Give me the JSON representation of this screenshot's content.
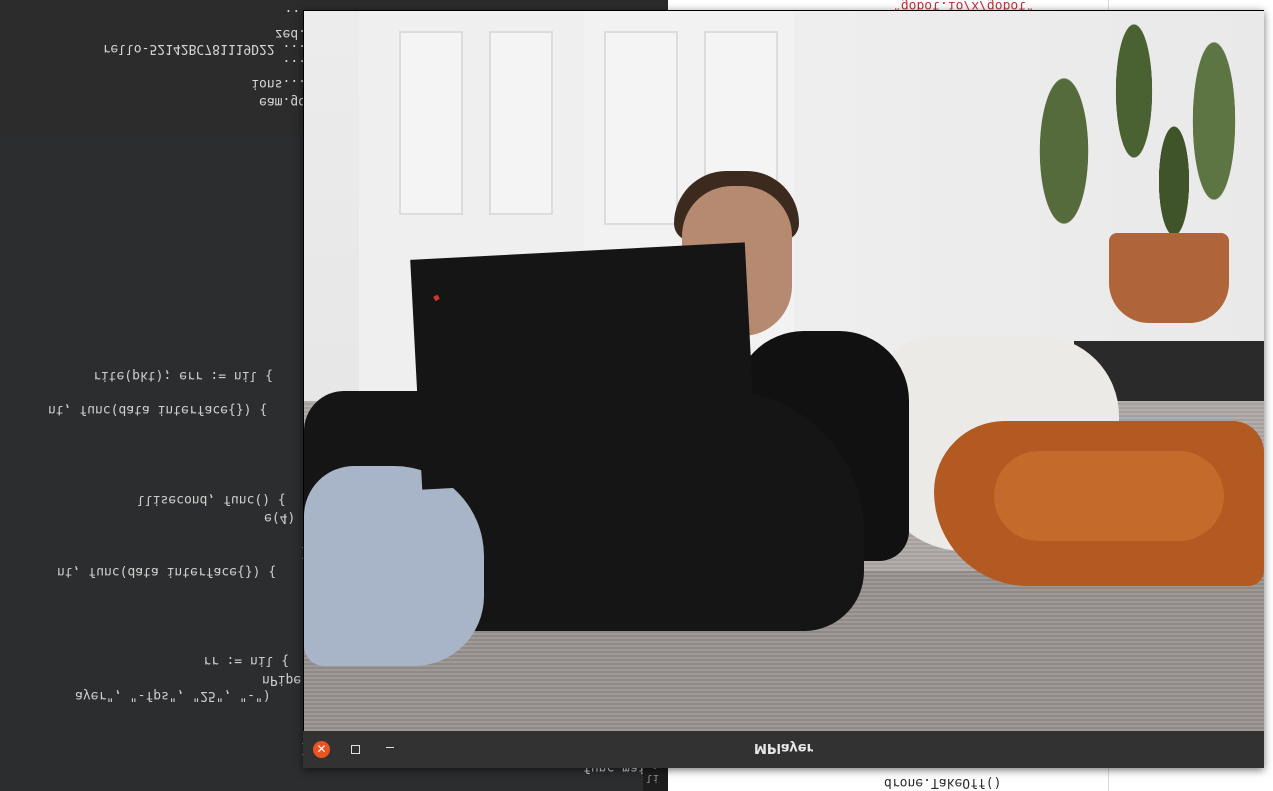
{
  "terminal": {
    "lines": [
      "...",
      "zed.",
      "rello-52142BC781119D22 ...",
      "...",
      "ions...",
      "eam.go"
    ]
  },
  "editor": {
    "lines": [
      "rite(pkt); err := nil {",
      "nt, func(data interface{}) {",
      "llisecond, func() {",
      "e(4)",
      ")",
      "nt, func(data interface{}) {",
      "rr := nil {",
      "nPipe()",
      "ayer\", \"-fps\", \"25\", \"-\")",
      ")",
      "func main() {"
    ],
    "gutter": [
      "cl",
      "li"
    ]
  },
  "right_editor": {
    "string_text": "\"gobot.io/x/gobot\"",
    "call_text": "drone.TakeOff()"
  },
  "mplayer": {
    "title": "MPlayer",
    "close_symbol": "✕",
    "accent": "#e95420"
  }
}
